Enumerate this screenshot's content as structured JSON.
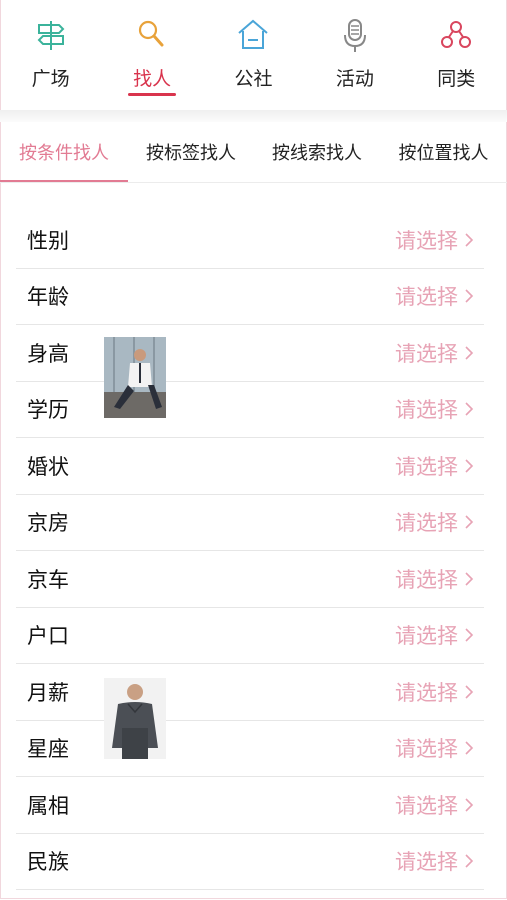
{
  "nav": {
    "items": [
      {
        "label": "广场",
        "icon": "signpost-icon",
        "active": false
      },
      {
        "label": "找人",
        "icon": "magnifier-icon",
        "active": true
      },
      {
        "label": "公社",
        "icon": "house-icon",
        "active": false
      },
      {
        "label": "活动",
        "icon": "microphone-icon",
        "active": false
      },
      {
        "label": "同类",
        "icon": "people-icon",
        "active": false
      }
    ]
  },
  "subtabs": [
    {
      "label": "按条件找人",
      "active": true
    },
    {
      "label": "按标签找人",
      "active": false
    },
    {
      "label": "按线索找人",
      "active": false
    },
    {
      "label": "按位置找人",
      "active": false
    }
  ],
  "filters": [
    {
      "label": "性别",
      "value": "请选择"
    },
    {
      "label": "年龄",
      "value": "请选择"
    },
    {
      "label": "身高",
      "value": "请选择"
    },
    {
      "label": "学历",
      "value": "请选择"
    },
    {
      "label": "婚状",
      "value": "请选择"
    },
    {
      "label": "京房",
      "value": "请选择"
    },
    {
      "label": "京车",
      "value": "请选择"
    },
    {
      "label": "户口",
      "value": "请选择"
    },
    {
      "label": "月薪",
      "value": "请选择"
    },
    {
      "label": "星座",
      "value": "请选择"
    },
    {
      "label": "属相",
      "value": "请选择"
    },
    {
      "label": "民族",
      "value": "请选择"
    }
  ],
  "colors": {
    "active_red": "#d9344d",
    "accent_pink": "#e27b93",
    "value_pink": "#e7a3b5"
  }
}
